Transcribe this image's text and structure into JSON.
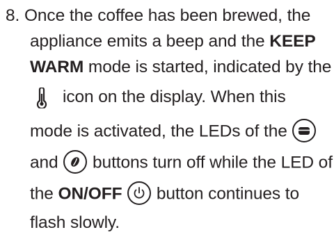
{
  "instruction": {
    "number": "8.",
    "line1": "Once the coffee has been brewed, the",
    "line2": "appliance emits a beep and the",
    "line2_bold": "KEEP",
    "line3_bold": "WARM",
    "line3": "mode is started, indicated by the",
    "line4": "icon on the display. When this",
    "line5": "mode is activated, the LEDs of the",
    "line6a": "and",
    "line6b": "buttons turn off while the LED of",
    "line7a": "the",
    "line7_bold": "ON/OFF",
    "line7b": "button continues to",
    "line8": "flash slowly."
  },
  "icons": {
    "thermometer": "thermometer-icon",
    "cup_button": "cup-button-icon",
    "bean_button": "coffee-bean-button-icon",
    "power_button": "power-button-icon"
  },
  "colors": {
    "text": "#231f20"
  }
}
